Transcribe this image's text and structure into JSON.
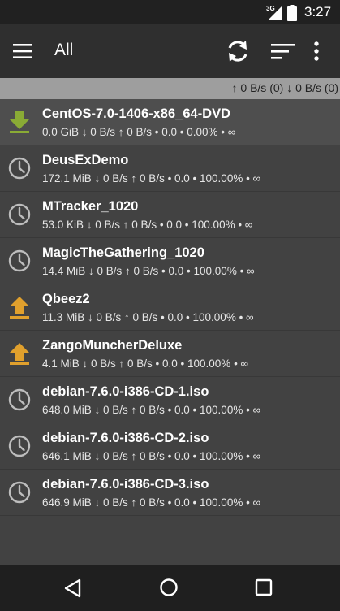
{
  "status_bar": {
    "network": "3G",
    "time": "3:27"
  },
  "app_bar": {
    "title": "All",
    "icons": [
      "menu-icon",
      "refresh-icon",
      "sort-icon",
      "overflow-menu-icon"
    ]
  },
  "speed_summary": {
    "text": "↑ 0 B/s (0)  ↓ 0 B/s (0)"
  },
  "colors": {
    "download": "#8aab35",
    "upload": "#e0a02d",
    "paused": "#bdbdbd"
  },
  "torrents": [
    {
      "name": "CentOS-7.0-1406-x86_64-DVD",
      "info": "0.0 GiB ↓ 0 B/s ↑ 0 B/s • 0.0 • 0.00% • ∞",
      "status": "downloading",
      "icon": "download-arrow-icon"
    },
    {
      "name": "DeusExDemo",
      "info": "172.1 MiB ↓ 0 B/s ↑ 0 B/s • 0.0 • 100.00% • ∞",
      "status": "paused",
      "icon": "clock-icon"
    },
    {
      "name": "MTracker_1020",
      "info": "53.0 KiB ↓ 0 B/s ↑ 0 B/s • 0.0 • 100.00% • ∞",
      "status": "paused",
      "icon": "clock-icon"
    },
    {
      "name": "MagicTheGathering_1020",
      "info": "14.4 MiB ↓ 0 B/s ↑ 0 B/s • 0.0 • 100.00% • ∞",
      "status": "paused",
      "icon": "clock-icon"
    },
    {
      "name": "Qbeez2",
      "info": "11.3 MiB ↓ 0 B/s ↑ 0 B/s • 0.0 • 100.00% • ∞",
      "status": "seeding",
      "icon": "upload-arrow-icon"
    },
    {
      "name": "ZangoMuncherDeluxe",
      "info": "4.1 MiB ↓ 0 B/s ↑ 0 B/s • 0.0 • 100.00% • ∞",
      "status": "seeding",
      "icon": "upload-arrow-icon"
    },
    {
      "name": "debian-7.6.0-i386-CD-1.iso",
      "info": "648.0 MiB ↓ 0 B/s ↑ 0 B/s • 0.0 • 100.00% • ∞",
      "status": "paused",
      "icon": "clock-icon"
    },
    {
      "name": "debian-7.6.0-i386-CD-2.iso",
      "info": "646.1 MiB ↓ 0 B/s ↑ 0 B/s • 0.0 • 100.00% • ∞",
      "status": "paused",
      "icon": "clock-icon"
    },
    {
      "name": "debian-7.6.0-i386-CD-3.iso",
      "info": "646.9 MiB ↓ 0 B/s ↑ 0 B/s • 0.0 • 100.00% • ∞",
      "status": "paused",
      "icon": "clock-icon"
    }
  ],
  "nav_bar": {
    "icons": [
      "back-icon",
      "home-icon",
      "recents-icon"
    ]
  }
}
